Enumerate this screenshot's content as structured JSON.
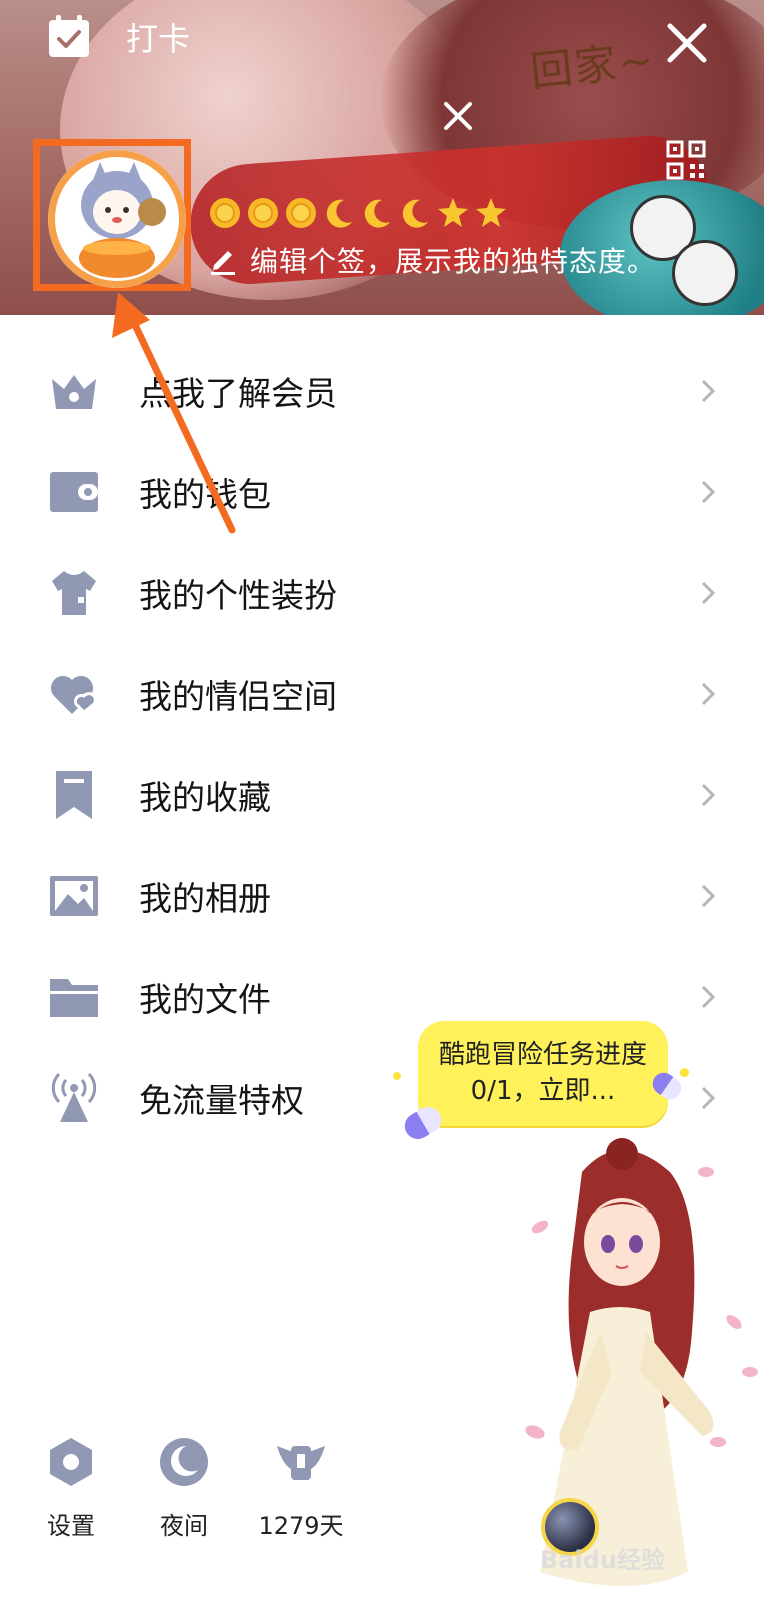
{
  "header": {
    "checkin_label": "打卡",
    "signature": "编辑个签，展示我的独特态度。",
    "banner_scribble": "回家~",
    "levels": [
      "sun",
      "sun",
      "sun",
      "moon",
      "moon",
      "moon",
      "star",
      "star"
    ]
  },
  "menu": {
    "items": [
      {
        "label": "点我了解会员",
        "icon": "crown-icon"
      },
      {
        "label": "我的钱包",
        "icon": "wallet-icon"
      },
      {
        "label": "我的个性装扮",
        "icon": "shirt-icon"
      },
      {
        "label": "我的情侣空间",
        "icon": "hearts-icon"
      },
      {
        "label": "我的收藏",
        "icon": "bookmark-icon"
      },
      {
        "label": "我的相册",
        "icon": "photo-icon"
      },
      {
        "label": "我的文件",
        "icon": "folder-icon"
      },
      {
        "label": "免流量特权",
        "icon": "signal-tower-icon"
      }
    ]
  },
  "task_bubble": {
    "text": "酷跑冒险任务进度0/1，立即..."
  },
  "bottom_bar": {
    "settings_label": "设置",
    "night_label": "夜间",
    "days_label": "1279天"
  },
  "watermark": "Baidu经验",
  "colors": {
    "icon_gray": "#9098b3",
    "highlight": "#f26b21",
    "bubble": "#fff15a"
  }
}
